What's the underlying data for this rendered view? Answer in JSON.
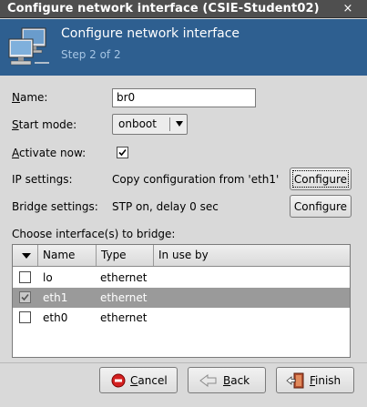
{
  "window": {
    "title": "Configure network interface (CSIE-Student02)",
    "close_glyph": "×"
  },
  "header": {
    "title": "Configure network interface",
    "step": "Step 2 of 2",
    "icon": "network-computers-icon"
  },
  "form": {
    "name_label_u": "N",
    "name_label_rest": "ame:",
    "name_value": "br0",
    "start_mode_label_u": "S",
    "start_mode_label_rest": "tart mode:",
    "start_mode_value": "onboot",
    "activate_label_u": "A",
    "activate_label_rest": "ctivate now:",
    "activate_checked": true,
    "ip_label": "IP settings:",
    "ip_value": "Copy configuration from 'eth1'",
    "ip_configure": "Configure",
    "bridge_label": "Bridge settings:",
    "bridge_value": "STP on, delay 0 sec",
    "bridge_configure": "Configure",
    "choose_label": "Choose interface(s) to bridge:"
  },
  "table": {
    "columns": [
      "",
      "Name",
      "Type",
      "In use by"
    ],
    "rows": [
      {
        "checked": false,
        "name": "lo",
        "type": "ethernet",
        "in_use_by": "",
        "selected": false
      },
      {
        "checked": true,
        "name": "eth1",
        "type": "ethernet",
        "in_use_by": "",
        "selected": true
      },
      {
        "checked": false,
        "name": "eth0",
        "type": "ethernet",
        "in_use_by": "",
        "selected": false
      }
    ]
  },
  "buttons": {
    "cancel_u": "C",
    "cancel_rest": "ancel",
    "back_u": "B",
    "back_rest": "ack",
    "finish_u": "F",
    "finish_rest": "inish"
  },
  "colors": {
    "header_bg": "#2e5f90",
    "titlebar_bg": "#4f4f4f",
    "selected_row": "#9a9a9a"
  }
}
